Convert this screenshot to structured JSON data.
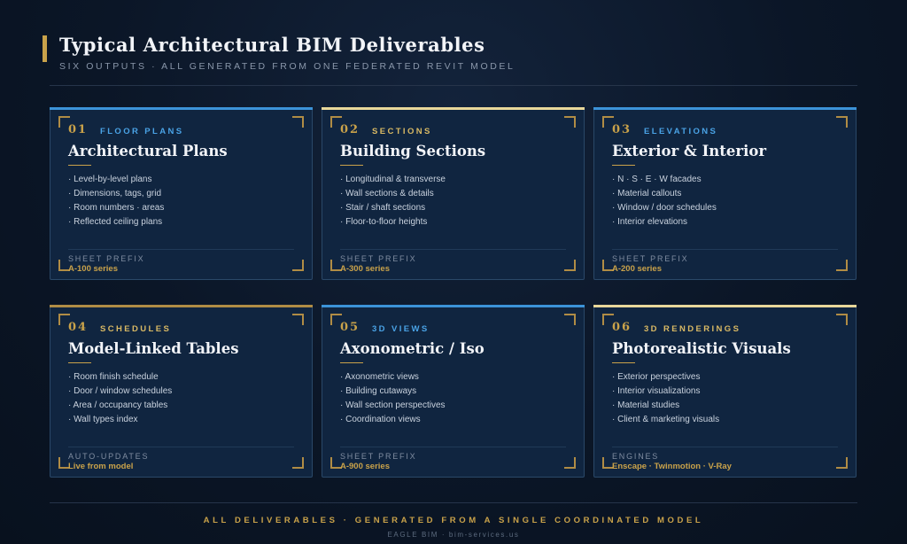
{
  "header": {
    "title": "Typical Architectural BIM Deliverables",
    "subtitle": "SIX OUTPUTS · ALL GENERATED FROM ONE FEDERATED REVIT MODEL"
  },
  "colors": {
    "gold": "#c9a24a",
    "blue_accent": "#4aa3e6",
    "card_bg": "#102540",
    "page_bg": "#0b1627"
  },
  "cards": [
    {
      "num": "01",
      "category": "FLOOR PLANS",
      "title": "Architectural Plans",
      "bullets": [
        "· Level-by-level plans",
        "· Dimensions, tags, grid",
        "· Room numbers · areas",
        "· Reflected ceiling plans"
      ],
      "footer_label": "SHEET PREFIX",
      "footer_value": "A-100 series"
    },
    {
      "num": "02",
      "category": "SECTIONS",
      "title": "Building Sections",
      "bullets": [
        "· Longitudinal & transverse",
        "· Wall sections & details",
        "· Stair / shaft sections",
        "· Floor-to-floor heights"
      ],
      "footer_label": "SHEET PREFIX",
      "footer_value": "A-300 series"
    },
    {
      "num": "03",
      "category": "ELEVATIONS",
      "title": "Exterior & Interior",
      "bullets": [
        "· N · S · E · W facades",
        "· Material callouts",
        "· Window / door schedules",
        "· Interior elevations"
      ],
      "footer_label": "SHEET PREFIX",
      "footer_value": "A-200 series"
    },
    {
      "num": "04",
      "category": "SCHEDULES",
      "title": "Model-Linked Tables",
      "bullets": [
        "· Room finish schedule",
        "· Door / window schedules",
        "· Area / occupancy tables",
        "· Wall types index"
      ],
      "footer_label": "AUTO-UPDATES",
      "footer_value": "Live from model"
    },
    {
      "num": "05",
      "category": "3D VIEWS",
      "title": "Axonometric / Iso",
      "bullets": [
        "· Axonometric views",
        "· Building cutaways",
        "· Wall section perspectives",
        "· Coordination views"
      ],
      "footer_label": "SHEET PREFIX",
      "footer_value": "A-900 series"
    },
    {
      "num": "06",
      "category": "3D RENDERINGS",
      "title": "Photorealistic Visuals",
      "bullets": [
        "· Exterior perspectives",
        "· Interior visualizations",
        "· Material studies",
        "· Client & marketing visuals"
      ],
      "footer_label": "ENGINES",
      "footer_value": "Enscape · Twinmotion · V-Ray"
    }
  ],
  "footer": {
    "main": "ALL DELIVERABLES · GENERATED FROM A SINGLE COORDINATED MODEL",
    "sub": "EAGLE BIM · bim-services.us"
  }
}
